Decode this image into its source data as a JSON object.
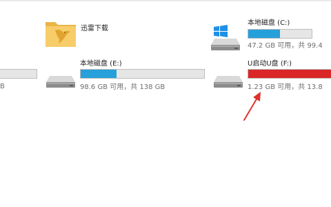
{
  "drives": {
    "partial_left": {
      "info_suffix": "B",
      "fill_fraction": 0.0
    },
    "xunlei": {
      "label": "迅雷下载"
    },
    "c": {
      "label": "本地磁盘 (C:)",
      "info": "47.2 GB 可用，共 99.4",
      "fill_fraction": 0.5,
      "fill_color": "#26a0da"
    },
    "e": {
      "label": "本地磁盘 (E:)",
      "info": "98.6 GB 可用，共 138 GB",
      "fill_fraction": 0.29,
      "fill_color": "#26a0da"
    },
    "f": {
      "label": "U启动U盘 (F:)",
      "info": "1.23 GB 可用，共 13.8",
      "fill_fraction": 0.99,
      "fill_color": "#da2626"
    }
  },
  "colors": {
    "annotation_arrow": "#e0302b",
    "folder": "#f5c55b"
  },
  "icons": {
    "windows-icon": "windows-logo",
    "drive-icon": "hard-drive",
    "folder-icon": "xunlei-folder"
  }
}
